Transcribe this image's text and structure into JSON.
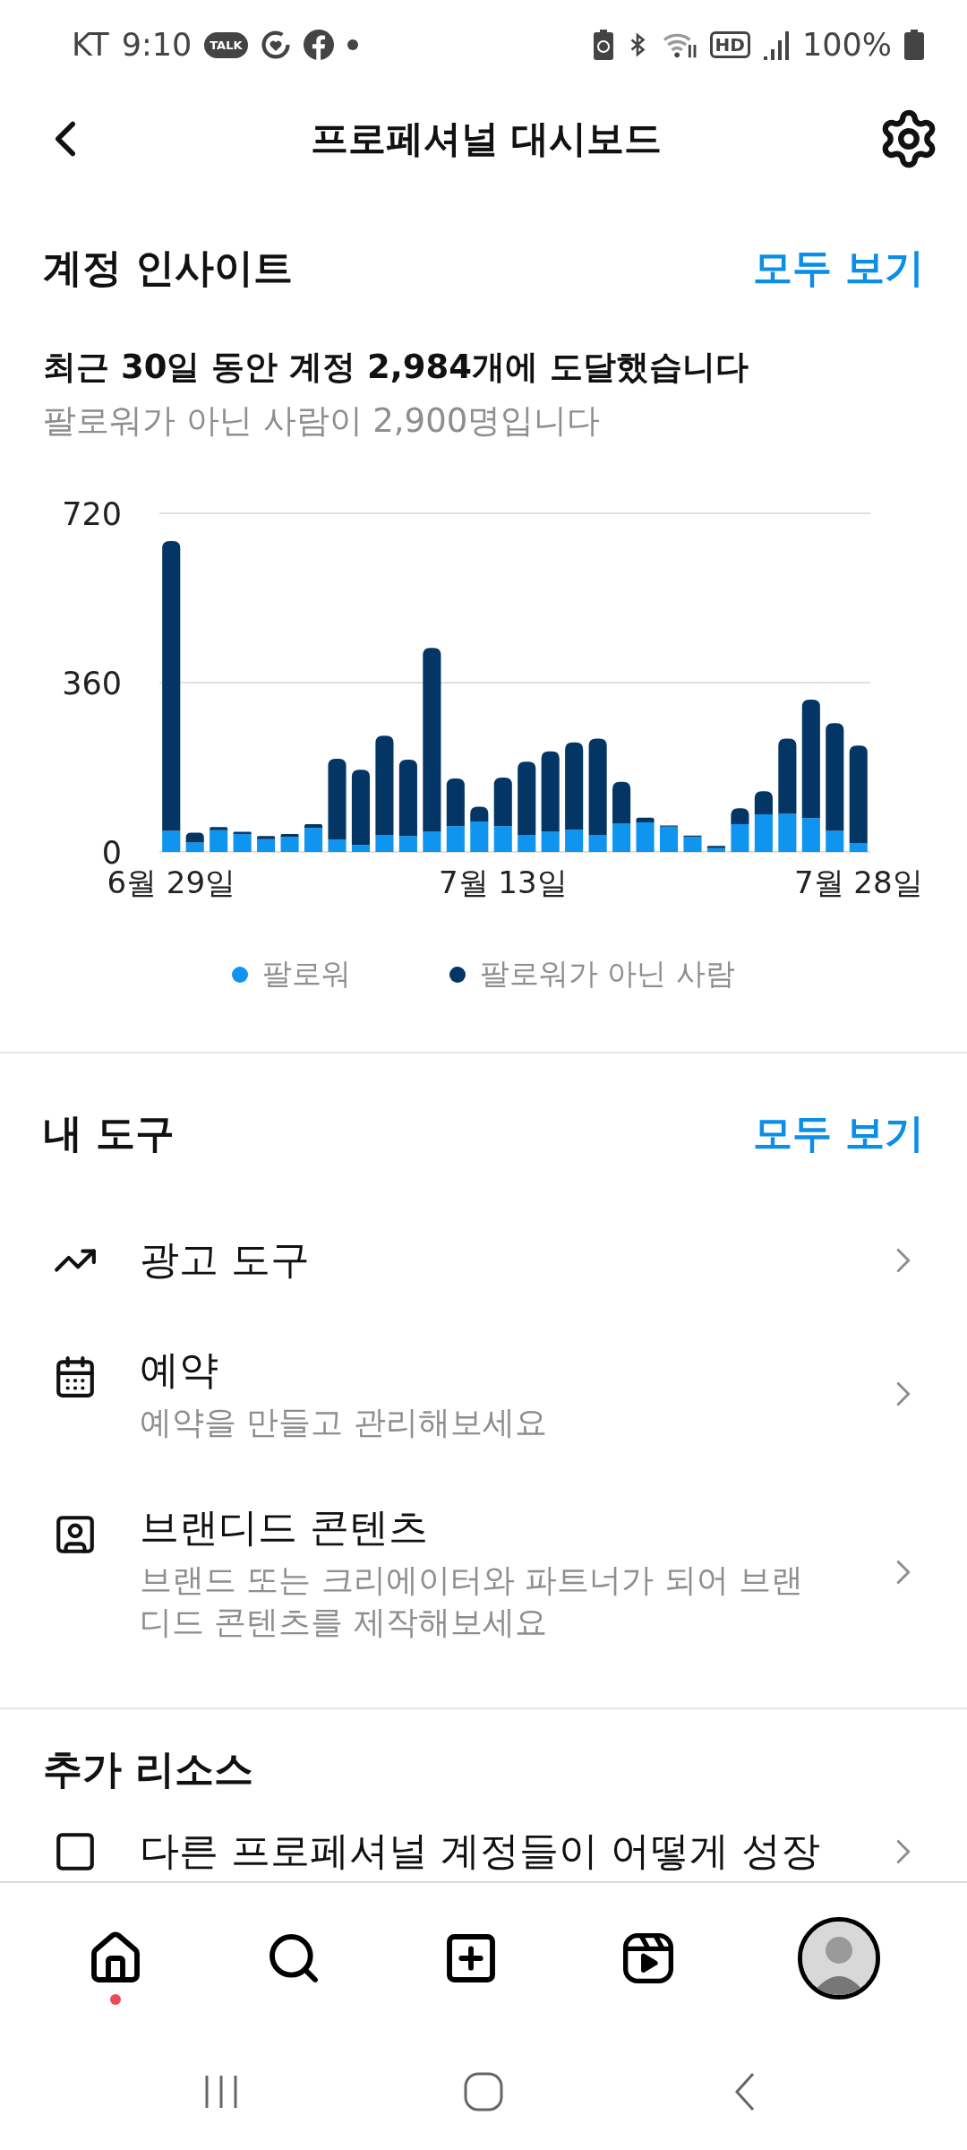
{
  "status_bar": {
    "carrier": "KT",
    "time": "9:10",
    "talk_label": "TALK",
    "hd_label": "HD",
    "battery_text": "100%"
  },
  "header": {
    "title": "프로페셔널 대시보드"
  },
  "insights": {
    "title": "계정 인사이트",
    "link": "모두 보기",
    "summary": "최근 30일 동안 계정 2,984개에 도달했습니다",
    "subtext": "팔로워가 아닌 사람이 2,900명입니다",
    "chart_data": {
      "type": "bar",
      "stacked": true,
      "ylim": [
        0,
        720
      ],
      "yticks": [
        0,
        360,
        720
      ],
      "categories": [
        "6월 29일",
        null,
        null,
        null,
        null,
        null,
        null,
        null,
        null,
        null,
        null,
        null,
        null,
        null,
        "7월 13일",
        null,
        null,
        null,
        null,
        null,
        null,
        null,
        null,
        null,
        null,
        null,
        null,
        null,
        null,
        "7월 28일"
      ],
      "series": [
        {
          "name": "팔로워",
          "color": "#0f95f0",
          "values": [
            45,
            20,
            46,
            38,
            27,
            32,
            51,
            26,
            15,
            36,
            34,
            43,
            55,
            65,
            55,
            36,
            43,
            47,
            36,
            60,
            63,
            54,
            32,
            8,
            59,
            80,
            81,
            72,
            45,
            18
          ]
        },
        {
          "name": "팔로워가 아닌 사람",
          "color": "#033664",
          "values": [
            616,
            21,
            7,
            5,
            7,
            6,
            8,
            172,
            160,
            211,
            162,
            391,
            101,
            31,
            103,
            156,
            171,
            186,
            205,
            89,
            10,
            2,
            3,
            5,
            34,
            49,
            160,
            252,
            229,
            208
          ]
        }
      ]
    }
  },
  "tools": {
    "title": "내 도구",
    "link": "모두 보기",
    "items": [
      {
        "kind": "ads",
        "title": "광고 도구"
      },
      {
        "kind": "schedule",
        "title": "예약",
        "subtitle": "예약을 만들고 관리해보세요"
      },
      {
        "kind": "branded",
        "title": "브랜디드 콘텐츠",
        "subtitle": "브랜드 또는 크리에이터와 파트너가 되어 브랜디드 콘텐츠를 제작해보세요"
      }
    ]
  },
  "resources": {
    "title": "추가 리소스",
    "items": [
      {
        "kind": "guide",
        "title": "다른 프로페셔널 계정들이 어떻게 성장"
      }
    ]
  },
  "nav": {
    "items": [
      {
        "kind": "home",
        "notification": true
      },
      {
        "kind": "search",
        "notification": false
      },
      {
        "kind": "create",
        "notification": false
      },
      {
        "kind": "reels",
        "notification": false
      },
      {
        "kind": "profile",
        "notification": false
      }
    ]
  }
}
